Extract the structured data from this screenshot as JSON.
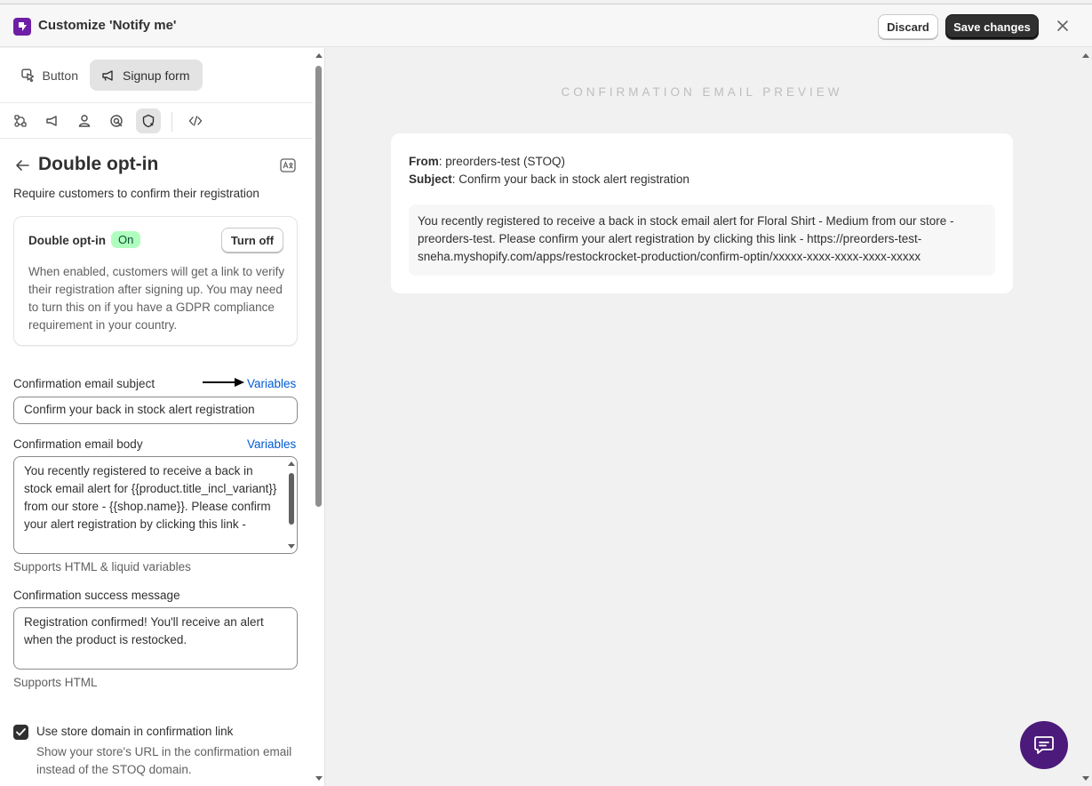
{
  "header": {
    "title": "Customize 'Notify me'",
    "discard_label": "Discard",
    "save_label": "Save changes"
  },
  "tabs": [
    {
      "label": "Button",
      "icon": "cursor-click-icon"
    },
    {
      "label": "Signup form",
      "icon": "megaphone-icon"
    }
  ],
  "toolbar": [
    "flow-icon",
    "megaphone-icon",
    "person-icon",
    "target-icon",
    "shield-icon",
    "code-icon"
  ],
  "section": {
    "title": "Double opt-in",
    "subtitle": "Require customers to confirm their registration"
  },
  "card": {
    "title": "Double opt-in",
    "status": "On",
    "toggle_label": "Turn off",
    "description": "When enabled, customers will get a link to verify their registration after signing up. You may need to turn this on if you have a GDPR compliance requirement in your country."
  },
  "subject": {
    "label": "Confirmation email subject",
    "variables_link": "Variables",
    "value": "Confirm your back in stock alert registration"
  },
  "body": {
    "label": "Confirmation email body",
    "variables_link": "Variables",
    "value": "You recently registered to receive a back in stock email alert for {{product.title_incl_variant}} from our store - {{shop.name}}. Please confirm your alert registration by clicking this link -",
    "help": "Supports HTML & liquid variables"
  },
  "success": {
    "label": "Confirmation success message",
    "value": "Registration confirmed! You'll receive an alert when the product is restocked.",
    "help": "Supports HTML"
  },
  "store_domain": {
    "checked": true,
    "label": "Use store domain in confirmation link",
    "description": "Show your store's URL in the confirmation email instead of the STOQ domain."
  },
  "preview": {
    "title": "CONFIRMATION EMAIL PREVIEW",
    "from_label": "From",
    "from_value": ": preorders-test (STOQ)",
    "subject_label": "Subject",
    "subject_value": ": Confirm your back in stock alert registration",
    "body": "You recently registered to receive a back in stock email alert for Floral Shirt - Medium from our store - preorders-test. Please confirm your alert registration by clicking this link - https://preorders-test-sneha.myshopify.com/apps/restockrocket-production/confirm-optin/xxxxx-xxxx-xxxx-xxxx-xxxxx"
  },
  "colors": {
    "accent_purple": "#6d1fa6",
    "chat_purple": "#4b1a7a",
    "link_blue": "#005bd3",
    "badge_green": "#affebf"
  }
}
